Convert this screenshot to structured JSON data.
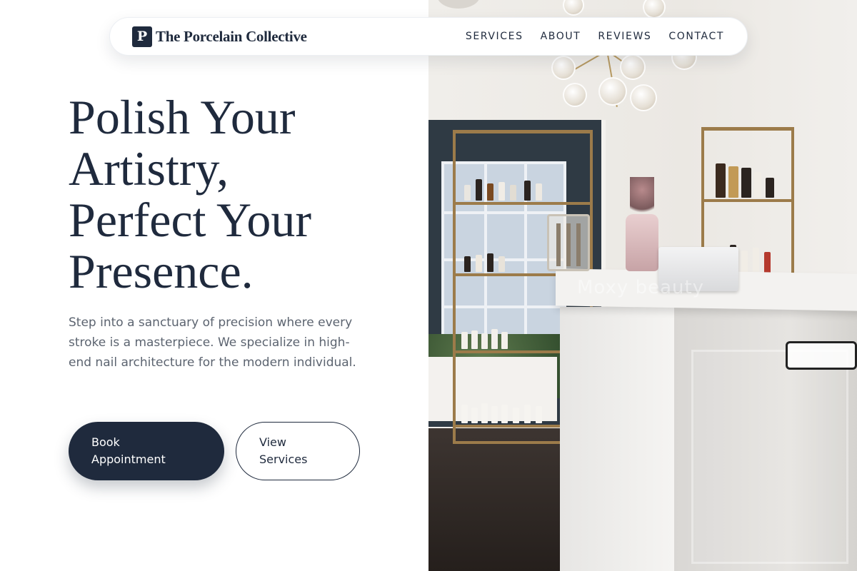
{
  "nav": {
    "brand_initial": "P",
    "brand_name": "The Porcelain Collective",
    "links": [
      "SERVICES",
      "ABOUT",
      "REVIEWS",
      "CONTACT"
    ]
  },
  "hero": {
    "title_lines": [
      "Polish Your",
      "Artistry,",
      "Perfect Your",
      "Presence."
    ],
    "description": "Step into a sanctuary of precision where every stroke is a masterpiece. We specialize in high-end nail architecture for the modern individual.",
    "primary_button_lines": [
      "Book",
      "Appointment"
    ],
    "secondary_button_lines": [
      "View",
      "Services"
    ]
  },
  "photo": {
    "subject": "salon-interior-photo",
    "watermark": "Moxy beauty"
  },
  "colors": {
    "primary": "#1f2a3d",
    "text_muted": "#5c6470",
    "background": "#ffffff"
  }
}
